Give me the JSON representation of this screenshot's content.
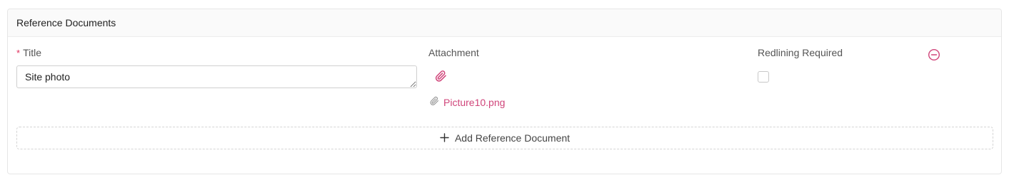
{
  "section": {
    "title": "Reference Documents"
  },
  "fields": {
    "title_required_mark": "*",
    "title_label": "Title",
    "title_value": "Site photo",
    "attachment_label": "Attachment",
    "attachment_file_name": "Picture10.png",
    "redlining_label": "Redlining Required",
    "redlining_checked": false
  },
  "actions": {
    "add_label": "Add Reference Document",
    "add_icon": "plus-icon",
    "remove_icon": "minus-circle-icon",
    "attach_icon": "paperclip-icon"
  },
  "colors": {
    "accent": "#d0457a",
    "required": "#e0305d",
    "border": "#d4d4d4"
  }
}
